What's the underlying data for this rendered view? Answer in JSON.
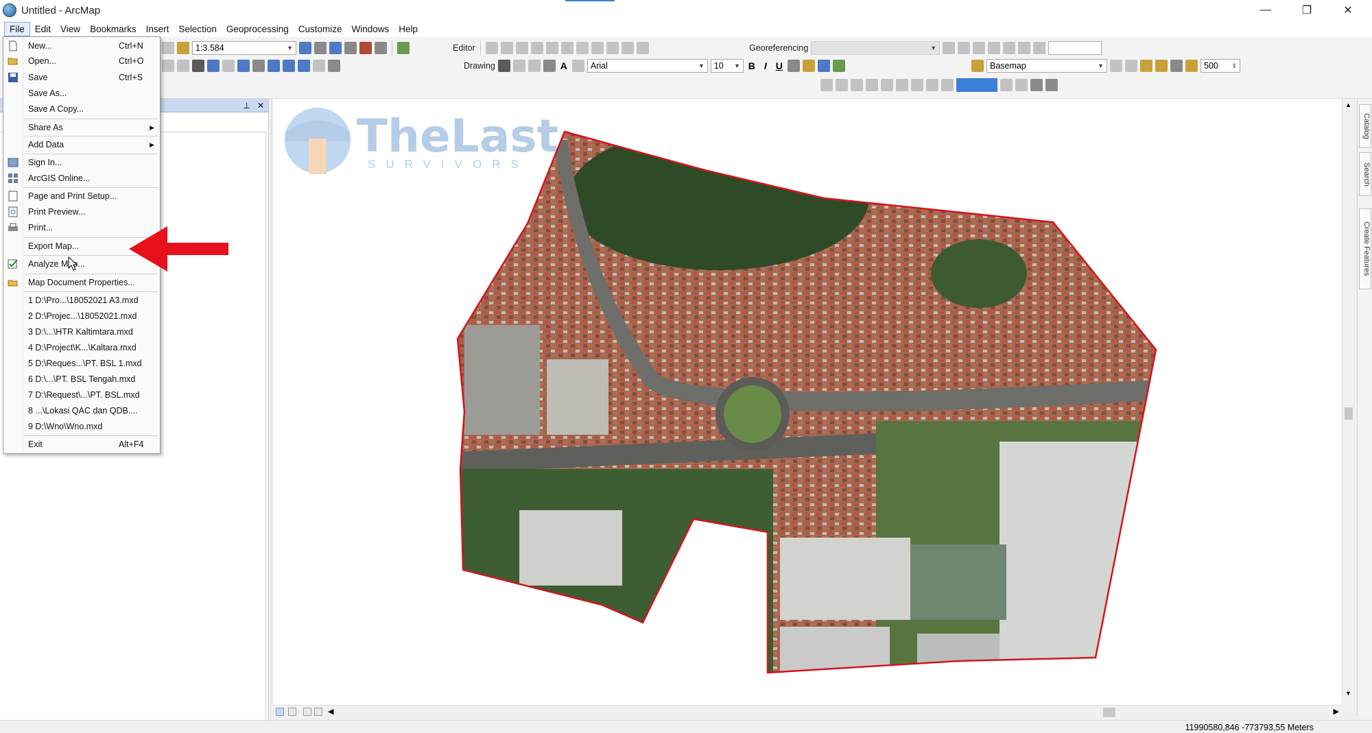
{
  "window": {
    "title": "Untitled - ArcMap",
    "controls": [
      "—",
      "❐",
      "✕"
    ]
  },
  "menubar": [
    "File",
    "Edit",
    "View",
    "Bookmarks",
    "Insert",
    "Selection",
    "Geoprocessing",
    "Customize",
    "Windows",
    "Help"
  ],
  "toolbar": {
    "scale": "1:3.584",
    "editor": "Editor",
    "georeferencing": "Georeferencing",
    "drawing": "Drawing",
    "font": "Arial",
    "font_size": "10",
    "bold": "B",
    "italic": "I",
    "underline": "U",
    "text_tool": "A",
    "basemap": "Basemap",
    "resolution": "500"
  },
  "file_menu": {
    "items": [
      {
        "label": "New...",
        "shortcut": "Ctrl+N",
        "icon": "new-document-icon"
      },
      {
        "label": "Open...",
        "shortcut": "Ctrl+O",
        "icon": "open-folder-icon"
      },
      {
        "label": "Save",
        "shortcut": "Ctrl+S",
        "icon": "save-icon"
      },
      {
        "label": "Save As...",
        "shortcut": ""
      },
      {
        "label": "Save A Copy...",
        "shortcut": ""
      },
      {
        "label": "Share As",
        "submenu": true
      },
      {
        "label": "Add Data",
        "submenu": true
      },
      {
        "label": "Sign In...",
        "icon": "sign-in-icon"
      },
      {
        "label": "ArcGIS Online...",
        "icon": "arcgis-online-icon"
      },
      {
        "label": "Page and Print Setup...",
        "icon": "page-setup-icon"
      },
      {
        "label": "Print Preview...",
        "icon": "print-preview-icon"
      },
      {
        "label": "Print...",
        "icon": "print-icon"
      },
      {
        "label": "Export Map..."
      },
      {
        "label": "Analyze Map...",
        "icon": "analyze-map-icon"
      },
      {
        "label": "Map Document Properties...",
        "icon": "document-properties-icon"
      },
      {
        "label": "1 D:\\Pro...\\18052021 A3.mxd"
      },
      {
        "label": "2 D:\\Projec...\\18052021.mxd"
      },
      {
        "label": "3 D:\\...\\HTR Kaltimtara.mxd"
      },
      {
        "label": "4 D:\\Project\\K...\\Kaltara.mxd"
      },
      {
        "label": "5 D:\\Reques...\\PT. BSL 1.mxd"
      },
      {
        "label": "6 D:\\...\\PT. BSL Tengah.mxd"
      },
      {
        "label": "7 D:\\Request\\...\\PT. BSL.mxd"
      },
      {
        "label": "8 ...\\Lokasi QAC dan QDB...."
      },
      {
        "label": "9 D:\\Wno\\Wno.mxd"
      },
      {
        "label": "Exit",
        "shortcut": "Alt+F4"
      }
    ]
  },
  "watermark": {
    "title": "TheLast",
    "subtitle": "SURVIVORS"
  },
  "side_tabs": [
    "Catalog",
    "Search",
    "Create Features"
  ],
  "status": {
    "coordinates": "11990580,846  -773793,55 Meters"
  },
  "colors": {
    "boundary": "#d4141c",
    "annotation_arrow": "#e8101a",
    "watermark": "#2a6fb7"
  }
}
